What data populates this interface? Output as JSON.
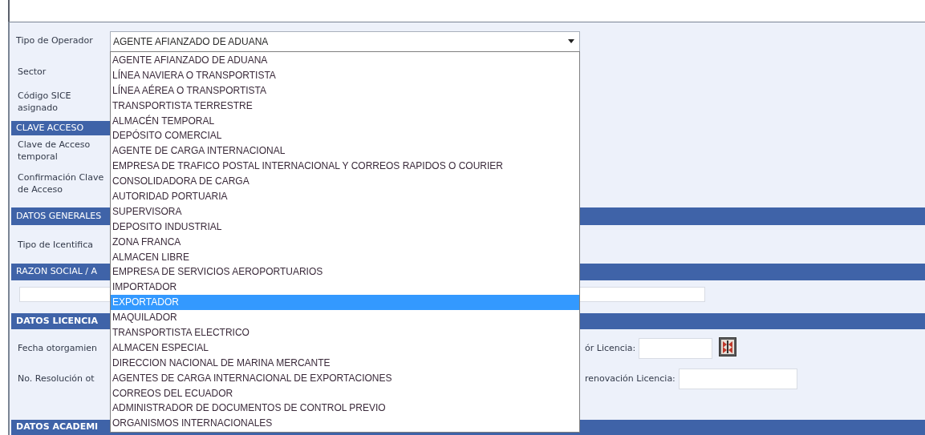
{
  "operator_field": {
    "label": "Tipo de Operador",
    "value": "AGENTE AFIANZADO DE ADUANA",
    "expanded": true
  },
  "dropdown_options": [
    {
      "label": "AGENTE AFIANZADO DE ADUANA",
      "selected": false
    },
    {
      "label": "LÍNEA NAVIERA O TRANSPORTISTA",
      "selected": false
    },
    {
      "label": "LÍNEA AÉREA O TRANSPORTISTA",
      "selected": false
    },
    {
      "label": "TRANSPORTISTA TERRESTRE",
      "selected": false
    },
    {
      "label": "ALMACÉN TEMPORAL",
      "selected": false
    },
    {
      "label": "DEPÓSITO COMERCIAL",
      "selected": false
    },
    {
      "label": "AGENTE DE CARGA INTERNACIONAL",
      "selected": false
    },
    {
      "label": "EMPRESA DE TRAFICO POSTAL INTERNACIONAL Y CORREOS RAPIDOS O COURIER",
      "selected": false
    },
    {
      "label": "CONSOLIDADORA DE CARGA",
      "selected": false
    },
    {
      "label": "AUTORIDAD PORTUARIA",
      "selected": false
    },
    {
      "label": "SUPERVISORA",
      "selected": false
    },
    {
      "label": "DEPOSITO INDUSTRIAL",
      "selected": false
    },
    {
      "label": "ZONA FRANCA",
      "selected": false
    },
    {
      "label": "ALMACEN LIBRE",
      "selected": false
    },
    {
      "label": "EMPRESA DE SERVICIOS AEROPORTUARIOS",
      "selected": false
    },
    {
      "label": "IMPORTADOR",
      "selected": false
    },
    {
      "label": "EXPORTADOR",
      "selected": true
    },
    {
      "label": "MAQUILADOR",
      "selected": false
    },
    {
      "label": "TRANSPORTISTA ELECTRICO",
      "selected": false
    },
    {
      "label": "ALMACEN ESPECIAL",
      "selected": false
    },
    {
      "label": "DIRECCION NACIONAL DE MARINA MERCANTE",
      "selected": false
    },
    {
      "label": "AGENTES DE CARGA INTERNACIONAL DE EXPORTACIONES",
      "selected": false
    },
    {
      "label": "CORREOS DEL ECUADOR",
      "selected": false
    },
    {
      "label": "ADMINISTRADOR DE DOCUMENTOS DE CONTROL PREVIO",
      "selected": false
    },
    {
      "label": "ORGANISMOS INTERNACIONALES",
      "selected": false
    }
  ],
  "form_rows": [
    {
      "kind": "field",
      "label": "Sector"
    },
    {
      "kind": "field",
      "label": "Código SICE asignado"
    },
    {
      "kind": "short_header",
      "label": "CLAVE ACCESO"
    },
    {
      "kind": "field",
      "label": "Clave de Acceso temporal"
    },
    {
      "kind": "field",
      "label": "Confirmación Clave de Acceso"
    },
    {
      "kind": "header",
      "label": "DATOS GENERALES",
      "bold": false
    },
    {
      "kind": "field",
      "label": "Tipo de Icentifica"
    },
    {
      "kind": "header",
      "label": "RAZON SOCIAL / A",
      "bold": false
    },
    {
      "kind": "text_input"
    },
    {
      "kind": "header",
      "label": "DATOS LICENCIA",
      "bold": true
    },
    {
      "kind": "split",
      "label": "Fecha otorgamien",
      "right_label": "ór Licencia:",
      "date_picker": true
    },
    {
      "kind": "split",
      "label": "No. Resolución ot",
      "right_label": "renovación Licencia:",
      "date_picker": false
    },
    {
      "kind": "header",
      "label": "DATOS ACADEMI",
      "bold": true
    }
  ]
}
